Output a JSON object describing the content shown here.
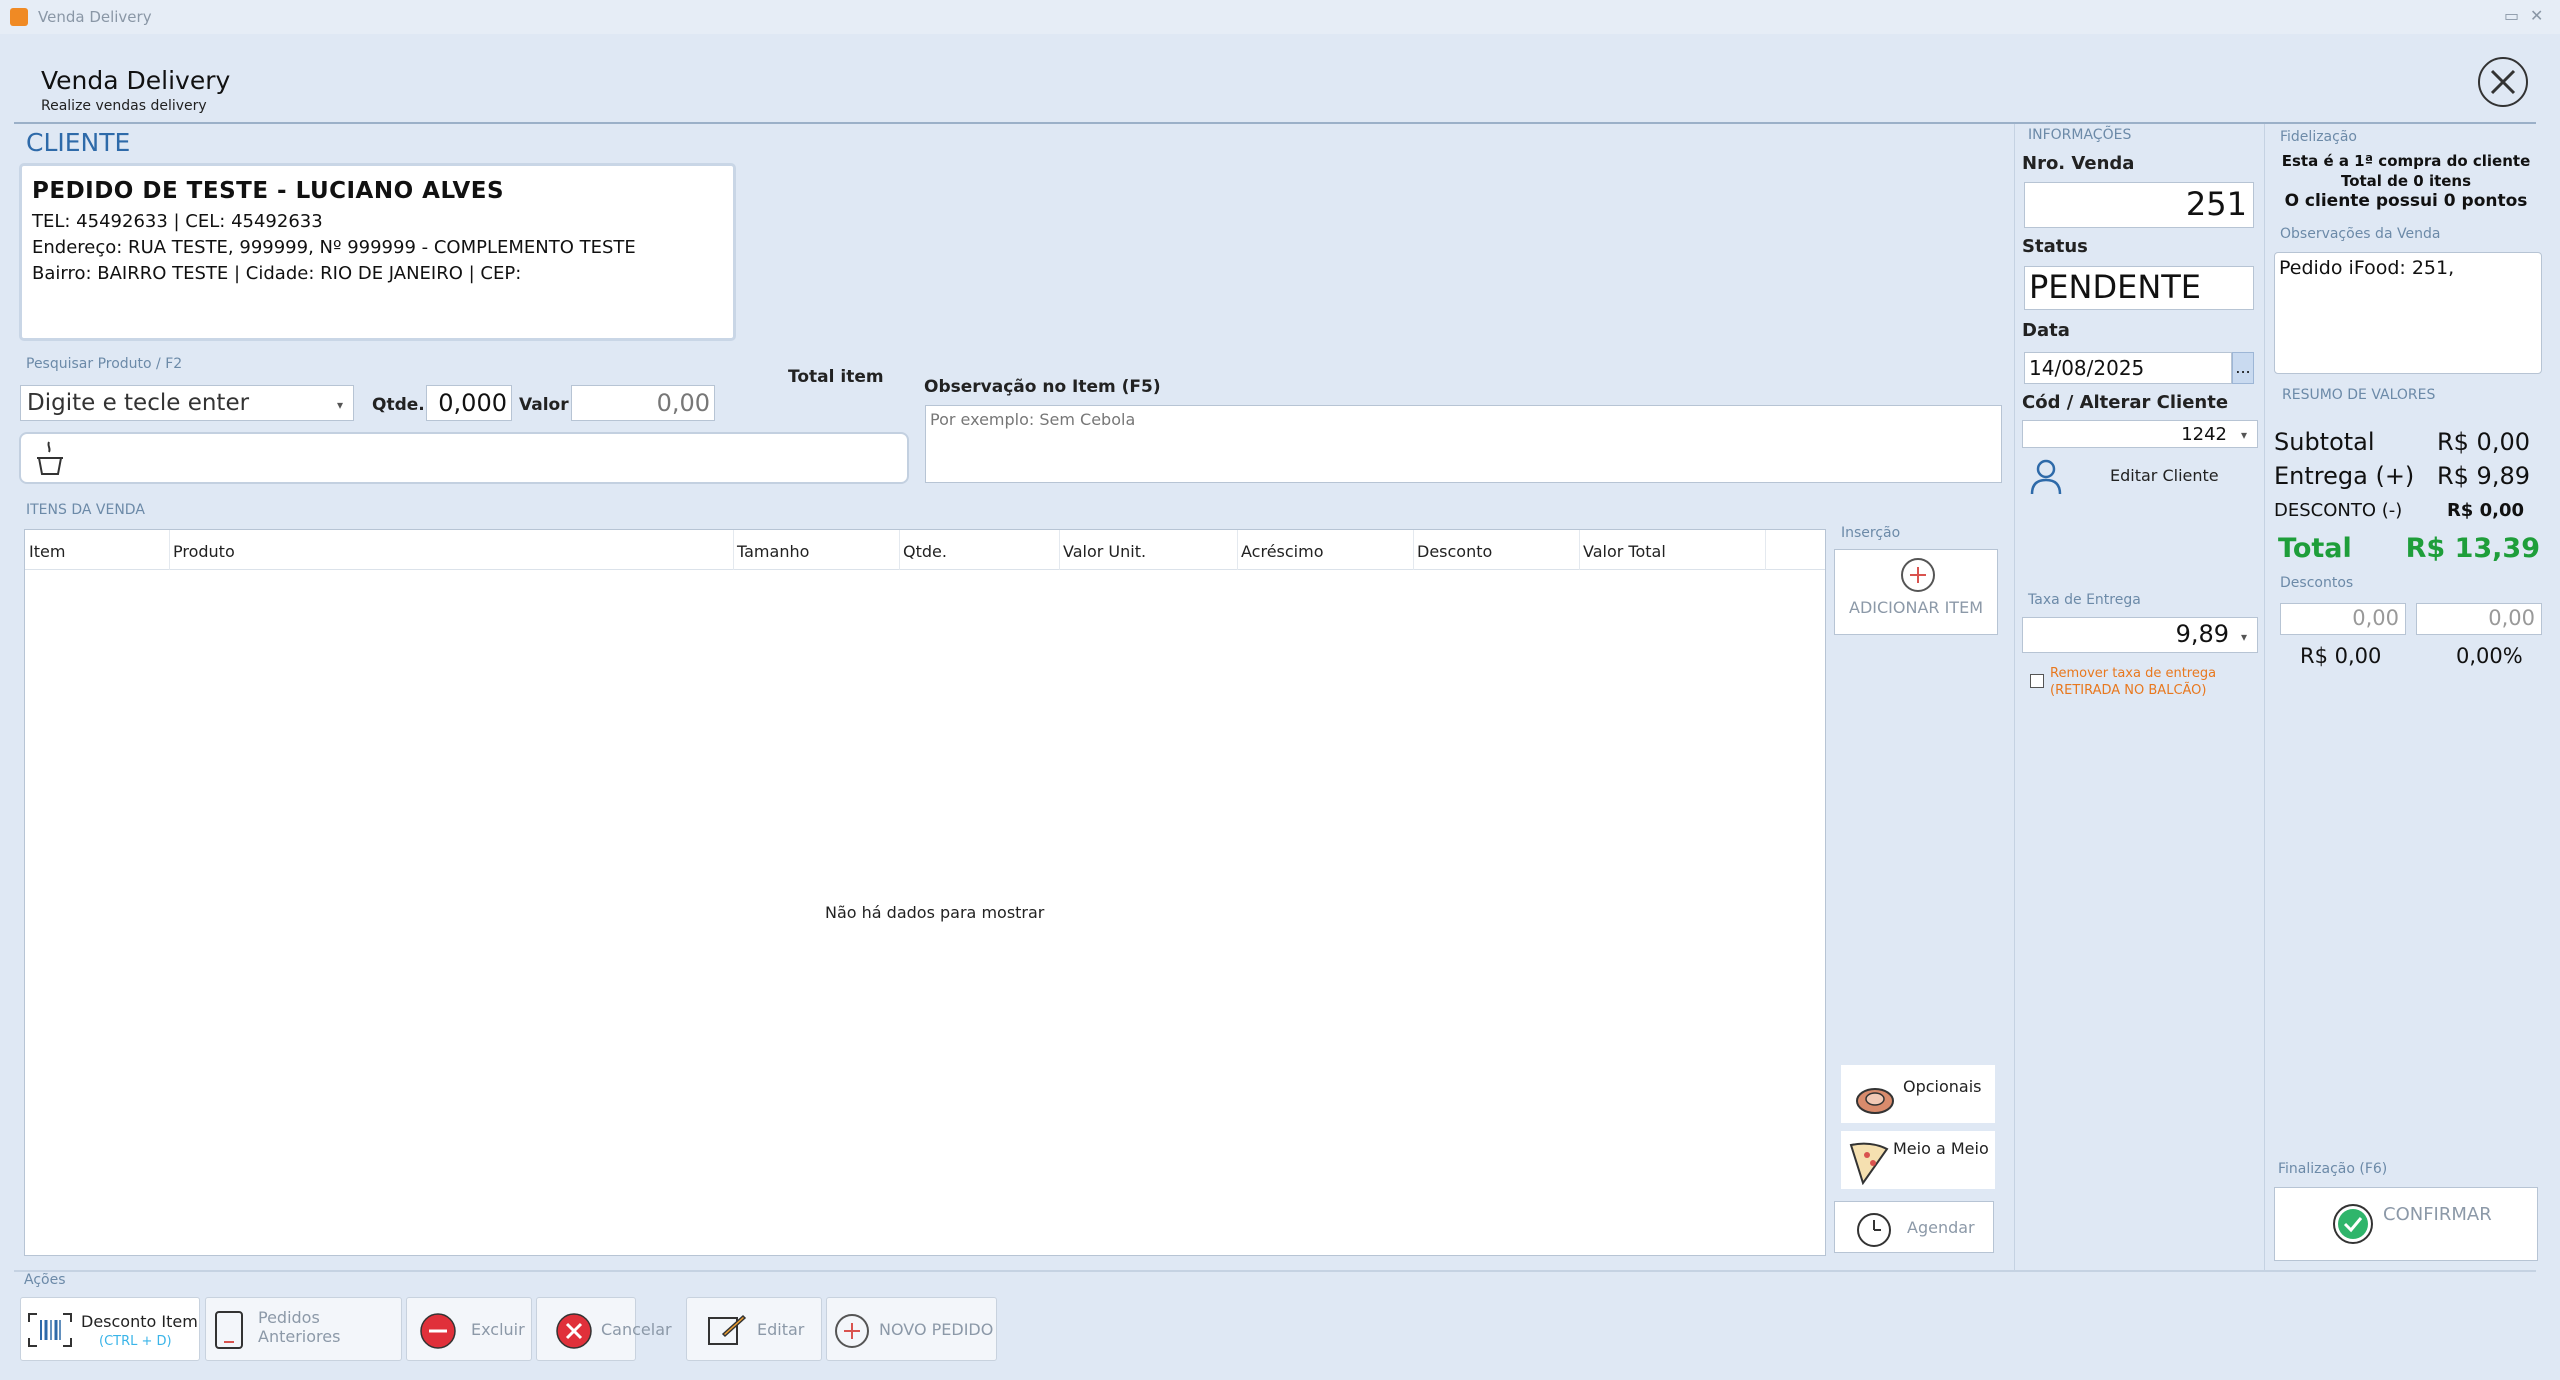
{
  "window": {
    "title": "Venda Delivery"
  },
  "header": {
    "title": "Venda Delivery",
    "subtitle": "Realize vendas delivery"
  },
  "cliente": {
    "section_label": "CLIENTE",
    "name": "PEDIDO DE TESTE -  LUCIANO ALVES",
    "phones": "TEL: 45492633  |  CEL: 45492633",
    "address": "Endereço: RUA TESTE, 999999, Nº 999999 - COMPLEMENTO TESTE",
    "district": "Bairro: BAIRRO TESTE  |  Cidade: RIO DE JANEIRO  |  CEP:"
  },
  "product_search": {
    "label": "Pesquisar Produto / F2",
    "input_value": "Digite e tecle enter",
    "qtde_label": "Qtde.",
    "qtde_value": "0,000",
    "valor_label": "Valor",
    "valor_value": "0,00",
    "total_item_label": "Total item",
    "obs_label": "Observação no Item (F5)",
    "obs_placeholder": "Por exemplo: Sem Cebola"
  },
  "items": {
    "section_label": "ITENS DA VENDA",
    "columns": [
      "Item",
      "Produto",
      "Tamanho",
      "Qtde.",
      "Valor Unit.",
      "Acréscimo",
      "Desconto",
      "Valor Total"
    ],
    "empty_message": "Não há dados para mostrar"
  },
  "insercao": {
    "label": "Inserção",
    "add_item": "ADICIONAR ITEM",
    "opcionais": "Opcionais",
    "meio_a_meio": "Meio a Meio",
    "agendar": "Agendar"
  },
  "informacoes": {
    "section_label": "INFORMAÇÕES",
    "nro_venda_label": "Nro. Venda",
    "nro_venda": "251",
    "status_label": "Status",
    "status": "PENDENTE",
    "data_label": "Data",
    "data": "14/08/2025",
    "data_btn": "...",
    "cliente_label": "Cód / Alterar Cliente",
    "cliente_code": "1242",
    "editar_cliente": "Editar Cliente",
    "taxa_label": "Taxa de Entrega",
    "taxa": "9,89",
    "remover_taxa_line1": "Remover taxa de entrega",
    "remover_taxa_line2": "(RETIRADA NO BALCÃO)"
  },
  "fidelizacao": {
    "section_label": "Fidelização",
    "line1": "Esta é a 1ª compra do cliente",
    "line2": "Total de 0 itens",
    "line3": "O cliente possui 0 pontos",
    "obs_label": "Observações da Venda",
    "obs_value": "Pedido iFood: 251,"
  },
  "resumo": {
    "section_label": "RESUMO DE VALORES",
    "subtotal_label": "Subtotal",
    "subtotal": "R$ 0,00",
    "entrega_label": "Entrega (+)",
    "entrega": "R$ 9,89",
    "desconto_label": "DESCONTO (-)",
    "desconto": "R$ 0,00",
    "total_label": "Total",
    "total": "R$ 13,39",
    "descontos_label": "Descontos",
    "desc_input1": "0,00",
    "desc_input2": "0,00",
    "desc_value": "R$ 0,00",
    "desc_percent": "0,00%",
    "finalizacao_label": "Finalização (F6)",
    "confirmar": "CONFIRMAR"
  },
  "acoes": {
    "section_label": "Ações",
    "desconto_item": "Desconto Item",
    "desconto_item_shortcut": "(CTRL + D)",
    "pedidos_anteriores": "Pedidos Anteriores",
    "excluir": "Excluir",
    "cancelar": "Cancelar",
    "editar": "Editar",
    "novo_pedido": "NOVO PEDIDO"
  },
  "colors": {
    "accent_blue": "#2e6aa9",
    "total_green": "#1e9e3a",
    "danger_red": "#e0303a",
    "warning_orange": "#e8781e",
    "background": "#dfe8f4"
  }
}
